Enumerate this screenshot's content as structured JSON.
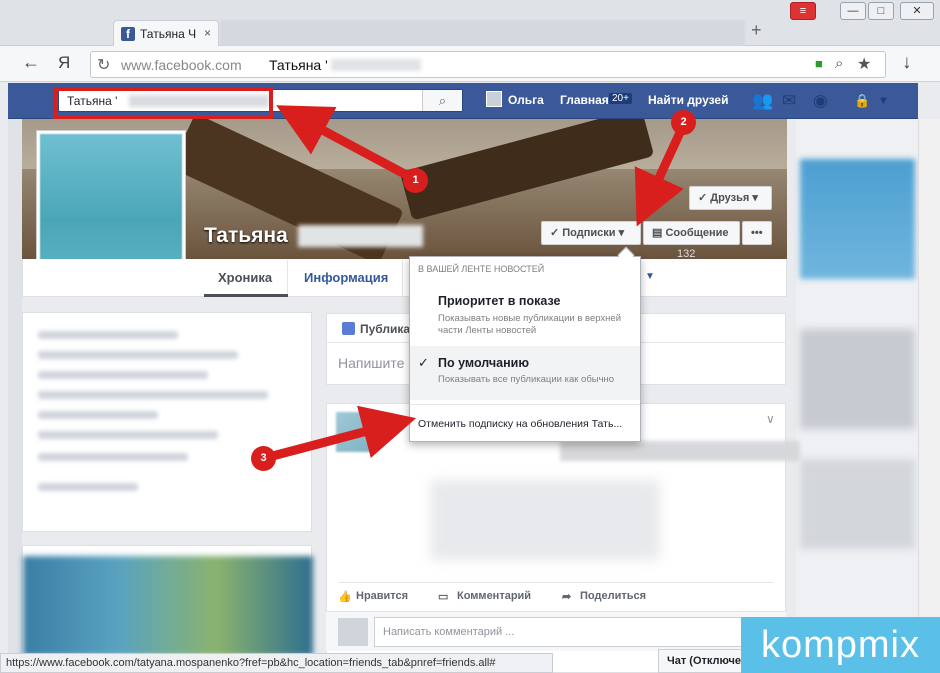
{
  "browser": {
    "tab_title": "Татьяна Ч",
    "tab_close": "×",
    "new_tab": "+",
    "window_controls": {
      "minimize": "—",
      "maximize": "□",
      "close": "✕"
    },
    "back": "←",
    "yandex": "Я",
    "reload": "↻",
    "url": "www.facebook.com",
    "url_title": "Татьяна '",
    "download": "↓",
    "status_url": "https://www.facebook.com/tatyana.mospanenko?fref=pb&hc_location=friends_tab&pnref=friends.all#"
  },
  "fb_header": {
    "search_value": "Татьяна '",
    "search_icon": "🔍",
    "user_name": "Ольга",
    "home_label": "Главная",
    "home_badge": "20+",
    "find_friends": "Найти друзей"
  },
  "profile": {
    "name": "Татьяна",
    "friends_button": "✓ Друзья ▾",
    "subscriptions_button": "✓ Подписки ▾",
    "message_button": "Сообщение",
    "more_button": "•••",
    "count": "132",
    "tabs": [
      "Хроника",
      "Информация"
    ]
  },
  "composer": {
    "tab_label": "Публикац",
    "placeholder": "Напишите ч"
  },
  "dropdown": {
    "header": "В вашей ленте новостей",
    "priority_title": "Приоритет в показе",
    "priority_desc": "Показывать новые публикации в верхней части Ленты новостей",
    "default_title": "По умолчанию",
    "default_desc": "Показывать все публикации как обычно",
    "check": "✓",
    "unsubscribe": "Отменить подписку на обновления Тать..."
  },
  "post": {
    "like": "Нравится",
    "comment": "Комментарий",
    "share": "Поделиться",
    "comment_placeholder": "Написать комментарий ..."
  },
  "chat": {
    "label": "Чат (Отключен)"
  },
  "annotations": {
    "n1": "1",
    "n2": "2",
    "n3": "3",
    "color": "#d91e1e"
  },
  "watermark": {
    "text": "kompmix"
  }
}
